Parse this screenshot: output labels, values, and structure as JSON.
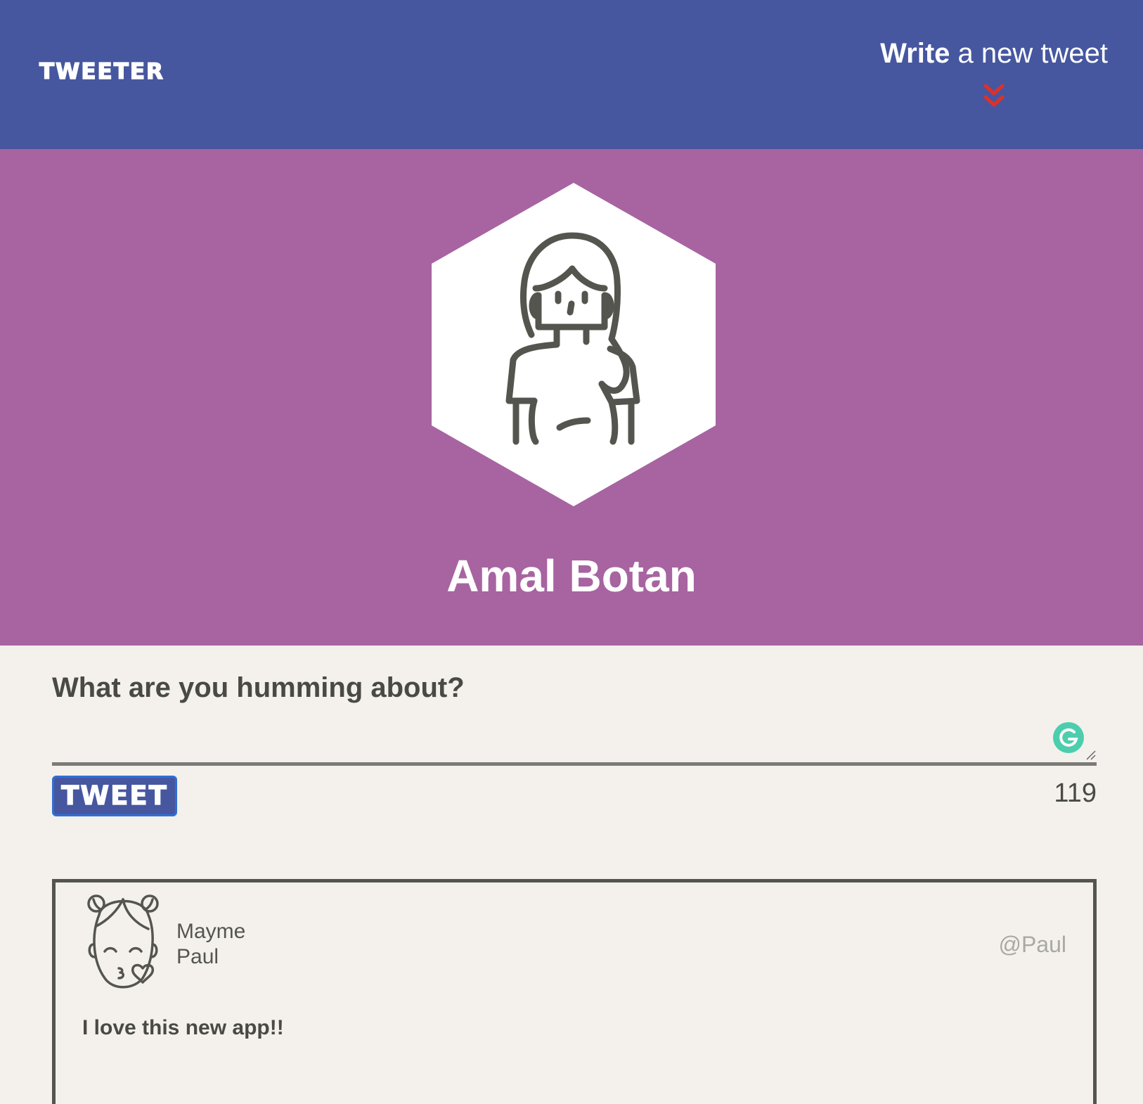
{
  "nav": {
    "brand": "TWEETER",
    "compose_bold": "Write",
    "compose_rest": " a new tweet",
    "compose_icon": "double-chevron-down-icon",
    "chevron_color": "#e0302a"
  },
  "profile": {
    "name": "Amal Botan",
    "avatar_icon": "woman-avatar-icon",
    "background_color": "#a764a1"
  },
  "composer": {
    "title": "What are you humming about?",
    "text_value": "",
    "button_label": "TWEET",
    "char_count": "119",
    "grammarly_icon": "grammarly-icon"
  },
  "tweets": [
    {
      "first_name": "Mayme",
      "last_name": "Paul",
      "handle": "@Paul",
      "content": "I love this new app!!",
      "avatar_icon": "girl-kiss-avatar-icon"
    }
  ],
  "colors": {
    "nav": "#4657a0",
    "page": "#f4f1ec",
    "text": "#4a4a45"
  }
}
